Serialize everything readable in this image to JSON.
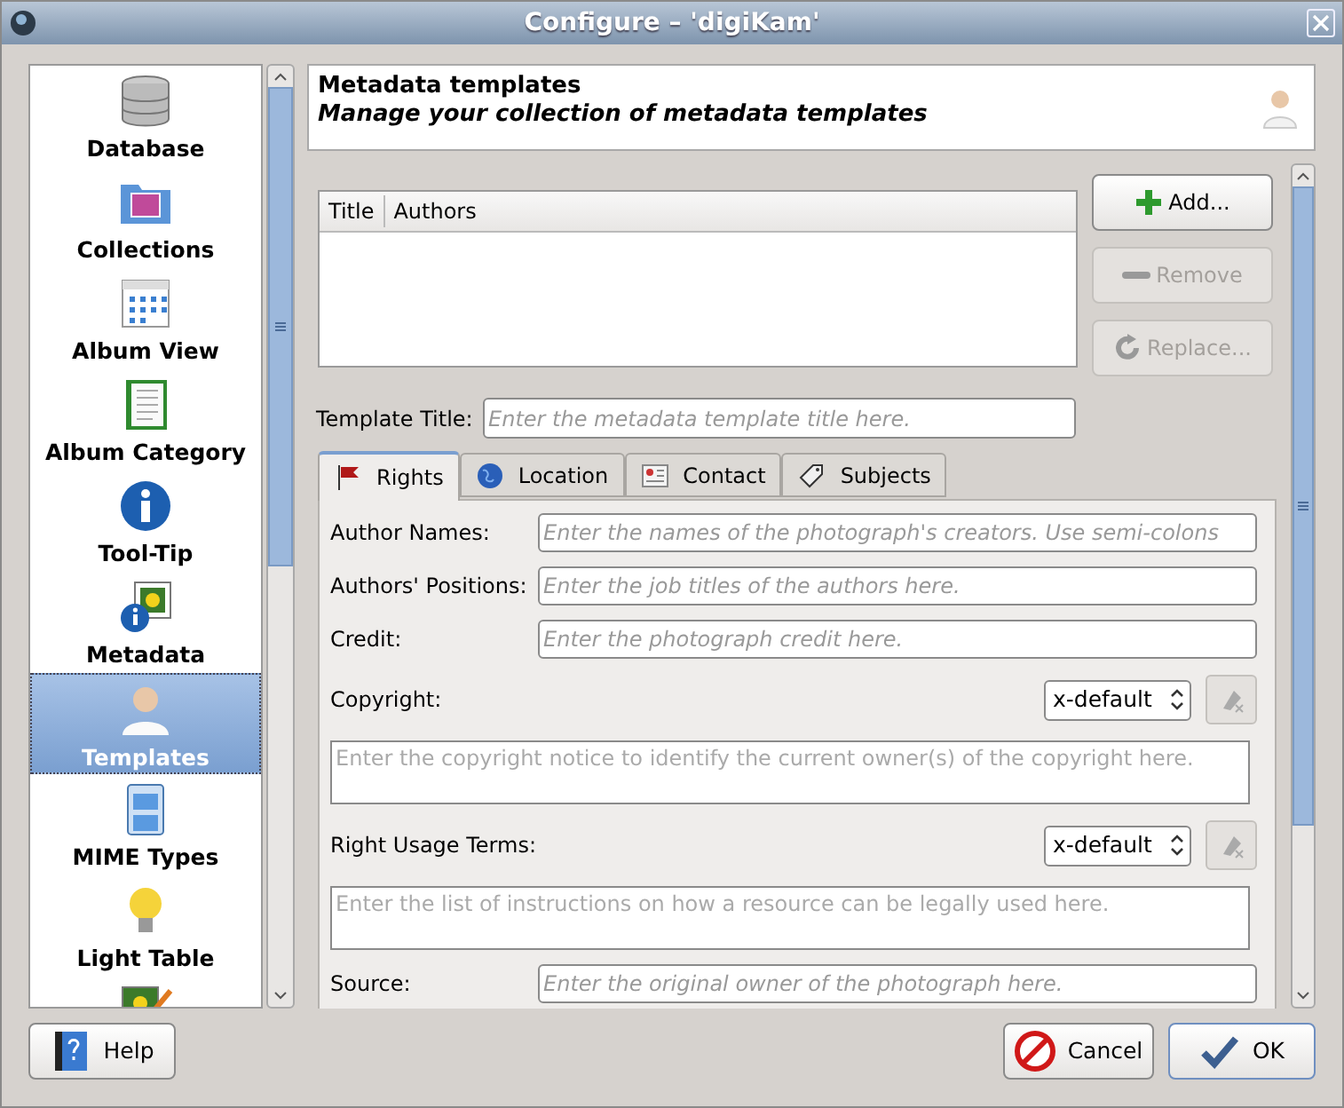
{
  "window": {
    "title": "Configure – 'digiKam'"
  },
  "sidebar": {
    "items": [
      {
        "label": "Database",
        "selected": false
      },
      {
        "label": "Collections",
        "selected": false
      },
      {
        "label": "Album View",
        "selected": false
      },
      {
        "label": "Album Category",
        "selected": false
      },
      {
        "label": "Tool-Tip",
        "selected": false
      },
      {
        "label": "Metadata",
        "selected": false
      },
      {
        "label": "Templates",
        "selected": true
      },
      {
        "label": "MIME Types",
        "selected": false
      },
      {
        "label": "Light Table",
        "selected": false
      }
    ]
  },
  "header": {
    "title": "Metadata templates",
    "subtitle": "Manage your collection of metadata templates"
  },
  "template_list": {
    "columns": [
      "Title",
      "Authors"
    ]
  },
  "list_buttons": [
    {
      "label": "Add...",
      "disabled": false
    },
    {
      "label": "Remove",
      "disabled": true
    },
    {
      "label": "Replace...",
      "disabled": true
    }
  ],
  "template_title": {
    "label": "Template Title:",
    "placeholder": "Enter the metadata template title here."
  },
  "tabs": [
    {
      "label": "Rights",
      "selected": true
    },
    {
      "label": "Location",
      "selected": false
    },
    {
      "label": "Contact",
      "selected": false
    },
    {
      "label": "Subjects",
      "selected": false
    }
  ],
  "fields": [
    {
      "kind": "line",
      "label": "Author Names:",
      "placeholder": "Enter the names of the photograph's creators. Use semi-colons"
    },
    {
      "kind": "line",
      "label": "Authors' Positions:",
      "placeholder": "Enter the job titles of the authors here."
    },
    {
      "kind": "line",
      "label": "Credit:",
      "placeholder": "Enter the photograph credit here."
    },
    {
      "kind": "multiline",
      "label": "Copyright:",
      "language": "x-default",
      "placeholder": "Enter the copyright notice to identify the current owner(s) of the copyright here."
    },
    {
      "kind": "multiline",
      "label": "Right Usage Terms:",
      "language": "x-default",
      "placeholder": "Enter the list of instructions on how a resource can be legally used here."
    },
    {
      "kind": "line",
      "label": "Source:",
      "placeholder": "Enter the original owner of the photograph here."
    }
  ],
  "footer_buttons": [
    {
      "kind": "help",
      "label": "Help"
    },
    {
      "kind": "cancel",
      "label": "Cancel"
    },
    {
      "kind": "ok",
      "label": "OK"
    }
  ]
}
